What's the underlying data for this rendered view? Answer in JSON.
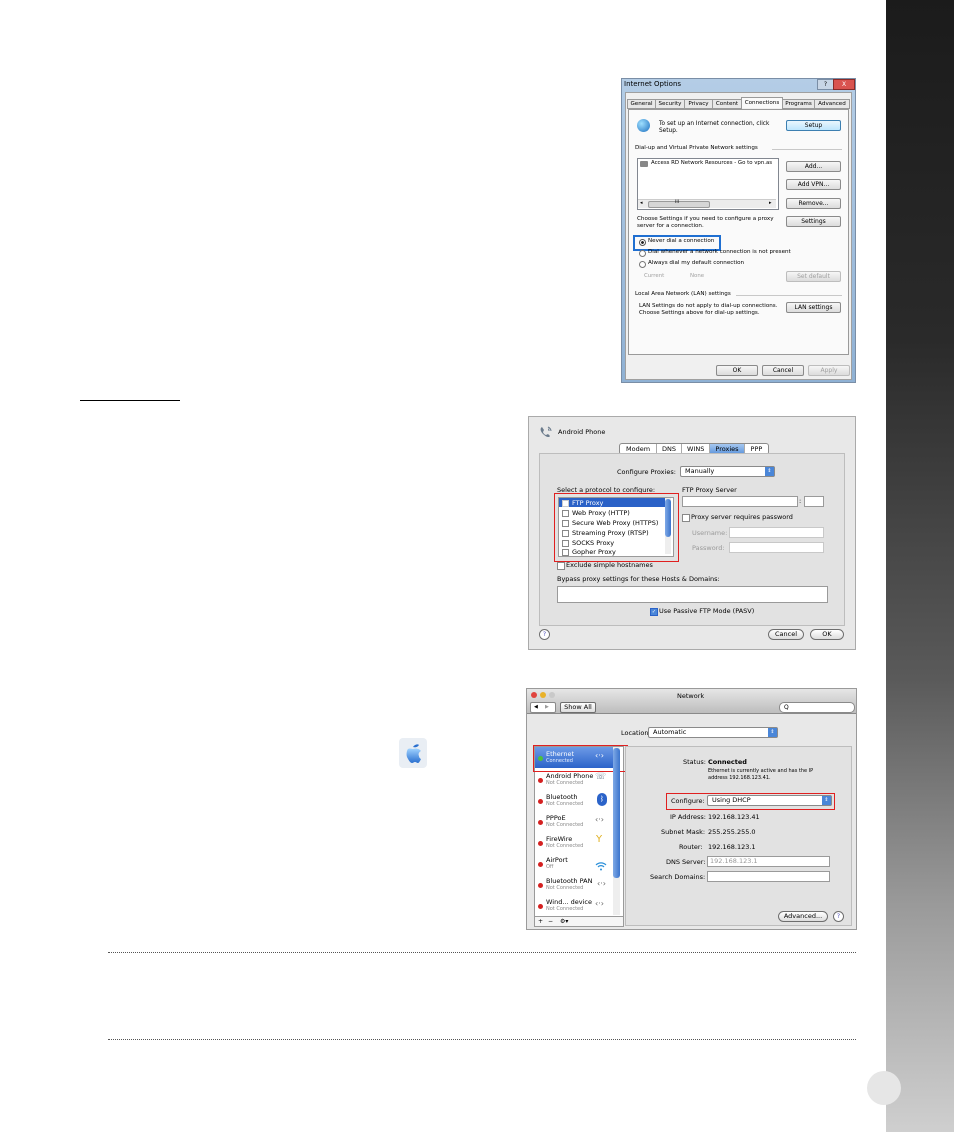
{
  "internet_options": {
    "title": "Internet Options",
    "title_buttons": [
      "?",
      "X"
    ],
    "tabs": [
      "General",
      "Security",
      "Privacy",
      "Content",
      "Connections",
      "Programs",
      "Advanced"
    ],
    "setup_text_1": "To set up an Internet connection, click",
    "setup_text_2": "Setup.",
    "setup_button": "Setup",
    "dialup_group": "Dial-up and Virtual Private Network settings",
    "vpn_item": "Access RD Network Resources - Go to vpn.as",
    "scroll_mid": "III",
    "add_button": "Add...",
    "add_vpn_button": "Add VPN...",
    "remove_button": "Remove...",
    "settings_text_1": "Choose Settings if you need to configure a proxy",
    "settings_text_2": "server for a connection.",
    "settings_button": "Settings",
    "radio_never": "Never dial a connection",
    "radio_whenever": "Dial whenever a network connection is not present",
    "radio_always": "Always dial my default connection",
    "current_label": "Current",
    "current_value": "None",
    "set_default_button": "Set default",
    "lan_group": "Local Area Network (LAN) settings",
    "lan_text_1": "LAN Settings do not apply to dial-up connections.",
    "lan_text_2": "Choose Settings above for dial-up settings.",
    "lan_button": "LAN settings",
    "ok": "OK",
    "cancel": "Cancel",
    "apply": "Apply"
  },
  "proxies": {
    "device_name": "Android Phone",
    "tabs": [
      "Modem",
      "DNS",
      "WINS",
      "Proxies",
      "PPP"
    ],
    "configure_label": "Configure Proxies:",
    "configure_value": "Manually",
    "select_label": "Select a protocol to configure:",
    "protocols": [
      "FTP Proxy",
      "Web Proxy (HTTP)",
      "Secure Web Proxy (HTTPS)",
      "Streaming Proxy (RTSP)",
      "SOCKS Proxy",
      "Gopher Proxy"
    ],
    "ftp_server_label": "FTP Proxy Server",
    "port_sep": ":",
    "requires_password": "Proxy server requires password",
    "username_label": "Username:",
    "password_label": "Password:",
    "exclude_label": "Exclude simple hostnames",
    "bypass_label": "Bypass proxy settings for these Hosts & Domains:",
    "passive_label": "Use Passive FTP Mode (PASV)",
    "help": "?",
    "cancel": "Cancel",
    "ok": "OK"
  },
  "network": {
    "title": "Network",
    "show_all": "Show All",
    "search_icon_glyph": "Q",
    "location_label": "Location:",
    "location_value": "Automatic",
    "services": [
      {
        "name": "Ethernet",
        "status": "Connected",
        "color": "#4cc23a"
      },
      {
        "name": "Android Phone",
        "status": "Not Connected",
        "color": "#d42020"
      },
      {
        "name": "Bluetooth",
        "status": "Not Connected",
        "color": "#d42020"
      },
      {
        "name": "PPPoE",
        "status": "Not Connected",
        "color": "#d42020"
      },
      {
        "name": "FireWire",
        "status": "Not Connected",
        "color": "#d42020"
      },
      {
        "name": "AirPort",
        "status": "Off",
        "color": "#d42020"
      },
      {
        "name": "Bluetooth PAN",
        "status": "Not Connected",
        "color": "#d42020"
      },
      {
        "name": "Wind... device",
        "status": "Not Connected",
        "color": "#d42020"
      }
    ],
    "list_controls": [
      "+",
      "−",
      "⚙▾"
    ],
    "status_label": "Status:",
    "status_value": "Connected",
    "status_desc_1": "Ethernet is currently active and has the IP",
    "status_desc_2": "address 192.168.123.41.",
    "configure_label": "Configure:",
    "configure_value": "Using DHCP",
    "ip_label": "IP Address:",
    "ip_value": "192.168.123.41",
    "mask_label": "Subnet Mask:",
    "mask_value": "255.255.255.0",
    "router_label": "Router:",
    "router_value": "192.168.123.1",
    "dns_label": "DNS Server:",
    "dns_value": "192.168.123.1",
    "search_label": "Search Domains:",
    "advanced_button": "Advanced...",
    "help": "?"
  },
  "apple_logo_icon": "apple-logo",
  "highlight_colors": {
    "blue": "#1f6fd1",
    "red": "#e02020"
  }
}
